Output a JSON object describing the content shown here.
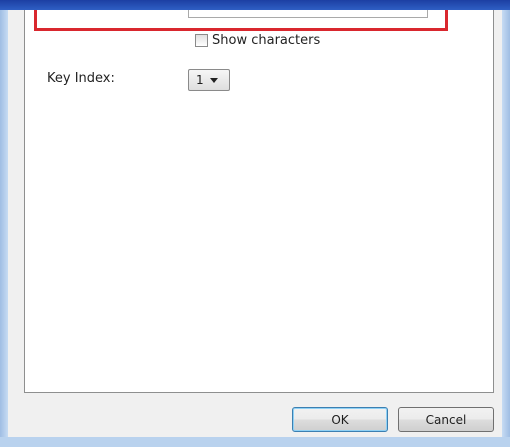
{
  "wireless_key": {
    "show_characters_label": "Show characters",
    "show_characters_checked": false,
    "key_index_label": "Key Index:",
    "key_index_value": "1"
  },
  "buttons": {
    "ok_label": "OK",
    "cancel_label": "Cancel"
  },
  "colors": {
    "highlight_border": "#d9272e",
    "title_bar": "#1c3fa3",
    "dialog_background": "#f0f0f0",
    "ok_button_border": "#3c7fb1"
  }
}
